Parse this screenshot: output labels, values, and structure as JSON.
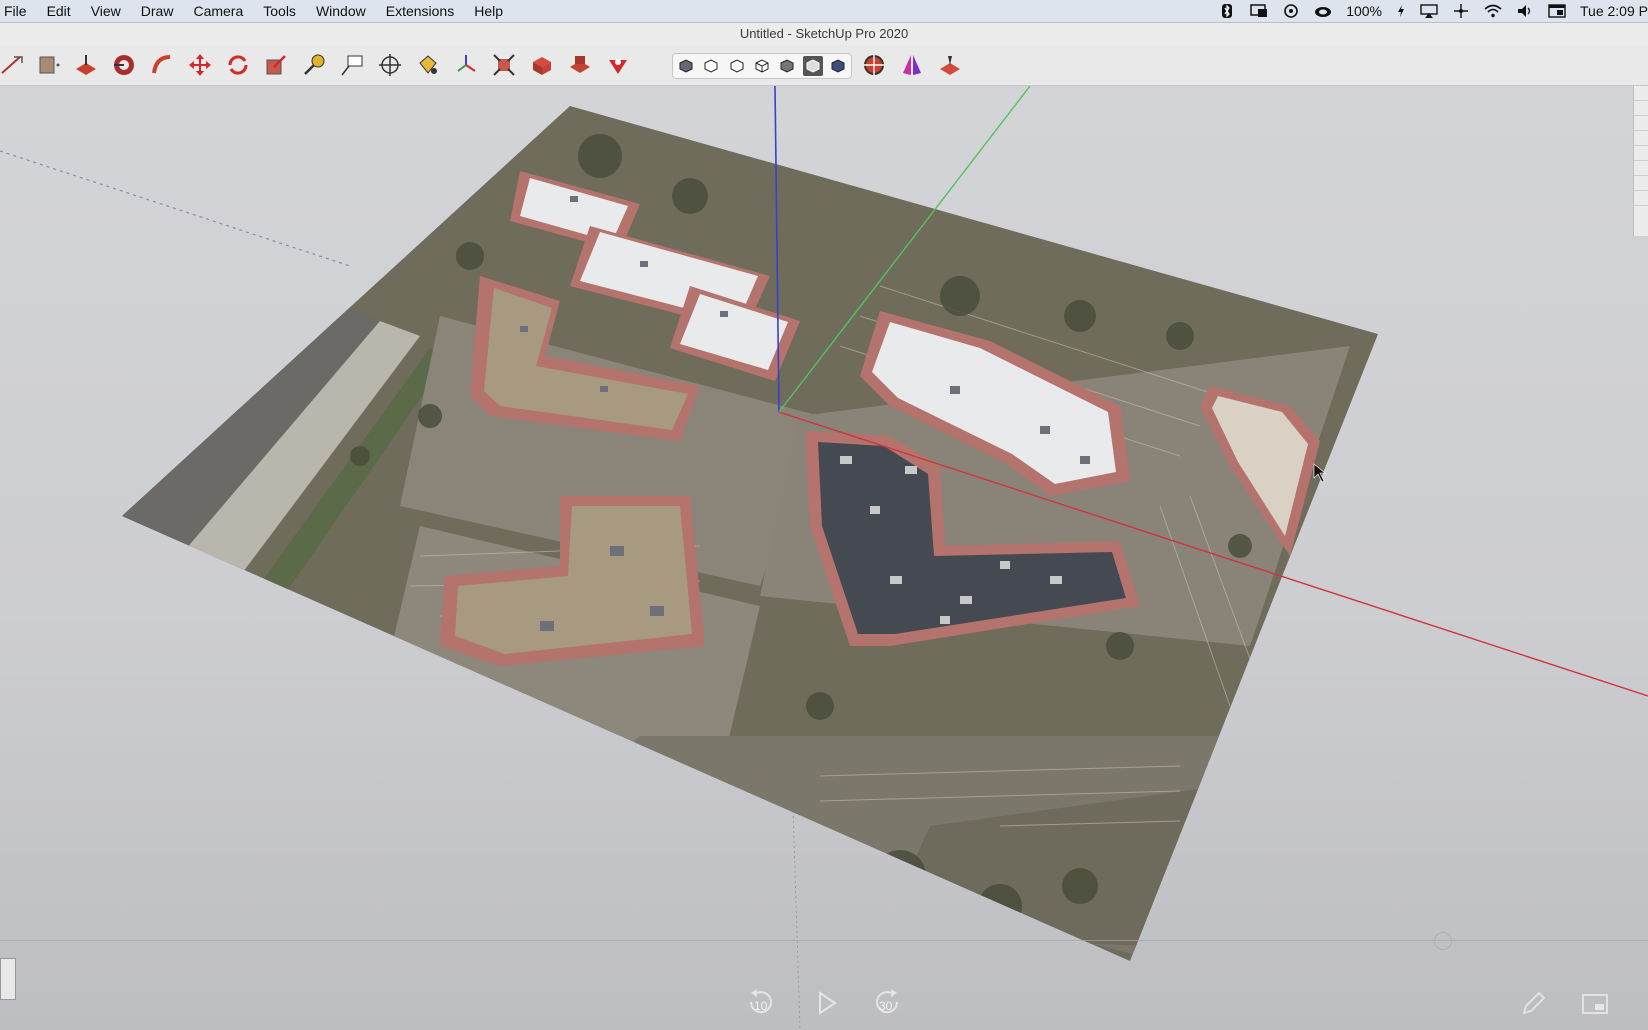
{
  "menubar": {
    "items": [
      "File",
      "Edit",
      "View",
      "Draw",
      "Camera",
      "Tools",
      "Window",
      "Extensions",
      "Help"
    ],
    "battery": "100%",
    "clock": "Tue 2:09 P"
  },
  "window": {
    "title": "Untitled - SketchUp Pro 2020"
  },
  "toolbar": {
    "tools": [
      {
        "name": "line-tool-icon"
      },
      {
        "name": "rectangle-tool-icon"
      },
      {
        "name": "push-pull-tool-icon"
      },
      {
        "name": "offset-tool-icon"
      },
      {
        "name": "follow-me-tool-icon"
      },
      {
        "name": "move-tool-icon"
      },
      {
        "name": "rotate-tool-icon"
      },
      {
        "name": "scale-tool-icon"
      },
      {
        "name": "tape-measure-icon"
      },
      {
        "name": "text-tool-icon"
      },
      {
        "name": "orbit-tool-icon"
      },
      {
        "name": "paint-bucket-icon"
      },
      {
        "name": "axes-tool-icon"
      },
      {
        "name": "zoom-extents-icon"
      },
      {
        "name": "components-icon"
      },
      {
        "name": "warehouse-icon"
      },
      {
        "name": "extension-warehouse-icon"
      }
    ],
    "styles": [
      "xray-style-icon",
      "back-edges-style-icon",
      "wireframe-style-icon",
      "hidden-line-style-icon",
      "shaded-style-icon",
      "shaded-textures-style-icon",
      "monochrome-style-icon"
    ],
    "active_style_index": 5,
    "right_tools": [
      "add-location-icon",
      "section-plane-icon",
      "sandbox-icon"
    ]
  },
  "viewport": {
    "axes_colors": {
      "red": "#d0343c",
      "green": "#56c25a",
      "blue": "#3b40c8"
    },
    "imagery": "aerial-photo"
  },
  "video_controls": {
    "rewind_label": "10",
    "forward_label": "30"
  },
  "colors": {
    "roof_rim": "#b5736d",
    "roof_light": "#e9eaec",
    "roof_tan": "#a79a80",
    "roof_dark": "#454a52",
    "pavement": "#8b8478",
    "ground": "#6f6c5c"
  }
}
